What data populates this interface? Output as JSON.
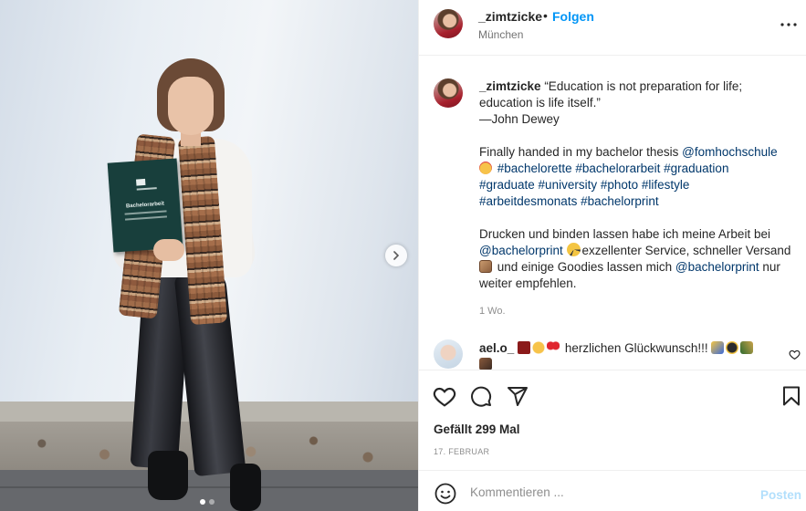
{
  "post": {
    "username": "_zimtzicke",
    "separator": "•",
    "follow_label": "Folgen",
    "location": "München",
    "carousel_dots": 2,
    "carousel_active": 0,
    "thesis_title": "Bachelorarbeit"
  },
  "caption": {
    "username": "_zimtzicke",
    "quote_line1": "“Education is not preparation for life;",
    "quote_line2": "education is life itself.”",
    "quote_author": "—John Dewey",
    "text1": "Finally handed in my bachelor thesis ",
    "mention1": "@fomhochschule",
    "hashtags_line1": "#bachelorette #bachelorarbeit #graduation",
    "hashtags_line2": "#graduate #university #photo #lifestyle",
    "hashtags_line3": "#arbeitdesmonats #bachelorprint",
    "text2a": "Drucken und binden lassen habe ich meine Arbeit bei",
    "mention2": "@bachelorprint",
    "text2b": "exzellenter Service, schneller Versand",
    "text2c": " und einige Goodies lassen mich ",
    "mention3": "@bachelorprint",
    "text2d": " nur",
    "text2e": "weiter empfehlen.",
    "age": "1 Wo."
  },
  "reply": {
    "username": "ael.o_",
    "text": "herzlichen Glückwunsch!!!"
  },
  "actions": {
    "likes": "Gefällt 299 Mal",
    "date": "17. FEBRUAR"
  },
  "comment_box": {
    "placeholder": "Kommentieren ...",
    "post_label": "Posten"
  },
  "colors": {
    "accent": "#0095f6",
    "tag": "#00376b",
    "muted": "#8e8e8e",
    "post_disabled": "#b2dffc"
  }
}
